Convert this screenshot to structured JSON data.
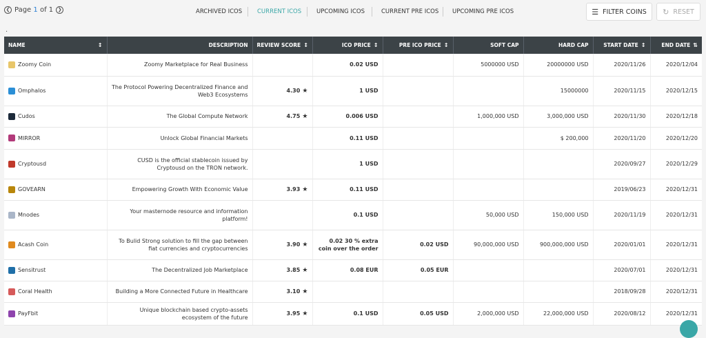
{
  "pager": {
    "label": "Page",
    "current": "1",
    "of": "of",
    "total": "1"
  },
  "tabs": [
    {
      "label": "ARCHIVED ICOS"
    },
    {
      "label": "CURRENT ICOS"
    },
    {
      "label": "UPCOMING ICOS"
    },
    {
      "label": "CURRENT PRE ICOS"
    },
    {
      "label": "UPCOMING PRE ICOS"
    }
  ],
  "active_tab": "CURRENT ICOS",
  "buttons": {
    "filter": "FILTER COINS",
    "reset": "RESET"
  },
  "dot": ".",
  "columns": [
    "NAME",
    "DESCRIPTION",
    "REVIEW SCORE",
    "ICO PRICE",
    "PRE ICO PRICE",
    "SOFT CAP",
    "HARD CAP",
    "START DATE",
    "END DATE"
  ],
  "rows": [
    {
      "name": "Zoomy Coin",
      "icon_color": "#e8c66a",
      "desc": "Zoomy Marketplace for Real Business",
      "score": "",
      "ico": "0.02 USD",
      "pre": "",
      "soft": "5000000 USD",
      "hard": "20000000 USD",
      "start": "2020/11/26",
      "end": "2020/12/04"
    },
    {
      "name": "Omphalos",
      "icon_color": "#2b8fd6",
      "desc": "The Protocol Powering Decentralized Finance and Web3 Ecosystems",
      "score": "4.30",
      "ico": "1 USD",
      "pre": "",
      "soft": "",
      "hard": "15000000",
      "start": "2020/11/15",
      "end": "2020/12/15"
    },
    {
      "name": "Cudos",
      "icon_color": "#1c2a3a",
      "desc": "The Global Compute Network",
      "score": "4.75",
      "ico": "0.006 USD",
      "pre": "",
      "soft": "1,000,000 USD",
      "hard": "3,000,000 USD",
      "start": "2020/11/30",
      "end": "2020/12/18"
    },
    {
      "name": "MIRROR",
      "icon_color": "#b23a7a",
      "desc": "Unlock Global Financial Markets",
      "score": "",
      "ico": "0.11 USD",
      "pre": "",
      "soft": "",
      "hard": "$ 200,000",
      "start": "2020/11/20",
      "end": "2020/12/20"
    },
    {
      "name": "Cryptousd",
      "icon_color": "#c0392b",
      "desc": "CUSD is the official stablecoin issued by Cryptousd on the TRON network.",
      "score": "",
      "ico": "1 USD",
      "pre": "",
      "soft": "",
      "hard": "",
      "start": "2020/09/27",
      "end": "2020/12/29"
    },
    {
      "name": "GOVEARN",
      "icon_color": "#b8860b",
      "desc": "Empowering Growth With Economic Value",
      "score": "3.93",
      "ico": "0.11 USD",
      "pre": "",
      "soft": "",
      "hard": "",
      "start": "2019/06/23",
      "end": "2020/12/31"
    },
    {
      "name": "Mnodes",
      "icon_color": "#aab6c8",
      "desc": "Your masternode resource and information platform!",
      "score": "",
      "ico": "0.1 USD",
      "pre": "",
      "soft": "50,000 USD",
      "hard": "150,000 USD",
      "start": "2020/11/19",
      "end": "2020/12/31"
    },
    {
      "name": "Acash Coin",
      "icon_color": "#e08a1e",
      "desc": "To Bulid Strong solution to fill the gap between fiat currencies and cryptocurrencies",
      "score": "3.90",
      "ico": "0.02 30 % extra coin over the order",
      "pre": "0.02 USD",
      "soft": "90,000,000 USD",
      "hard": "900,000,000 USD",
      "start": "2020/01/01",
      "end": "2020/12/31"
    },
    {
      "name": "Sensitrust",
      "icon_color": "#1f6fa8",
      "desc": "The Decentralized Job Marketplace",
      "score": "3.85",
      "ico": "0.08 EUR",
      "pre": "0.05 EUR",
      "soft": "",
      "hard": "",
      "start": "2020/07/01",
      "end": "2020/12/31"
    },
    {
      "name": "Coral Health",
      "icon_color": "#d65a5a",
      "desc": "Building a More Connected Future in Healthcare",
      "score": "3.10",
      "ico": "",
      "pre": "",
      "soft": "",
      "hard": "",
      "start": "2018/09/28",
      "end": "2020/12/31"
    },
    {
      "name": "PayFbit",
      "icon_color": "#8e44ad",
      "desc": "Unique blockchain based crypto-assets ecosystem of the future",
      "score": "3.95",
      "ico": "0.1 USD",
      "pre": "0.05 USD",
      "soft": "2,000,000 USD",
      "hard": "22,000,000 USD",
      "start": "2020/08/12",
      "end": "2020/12/31"
    }
  ]
}
